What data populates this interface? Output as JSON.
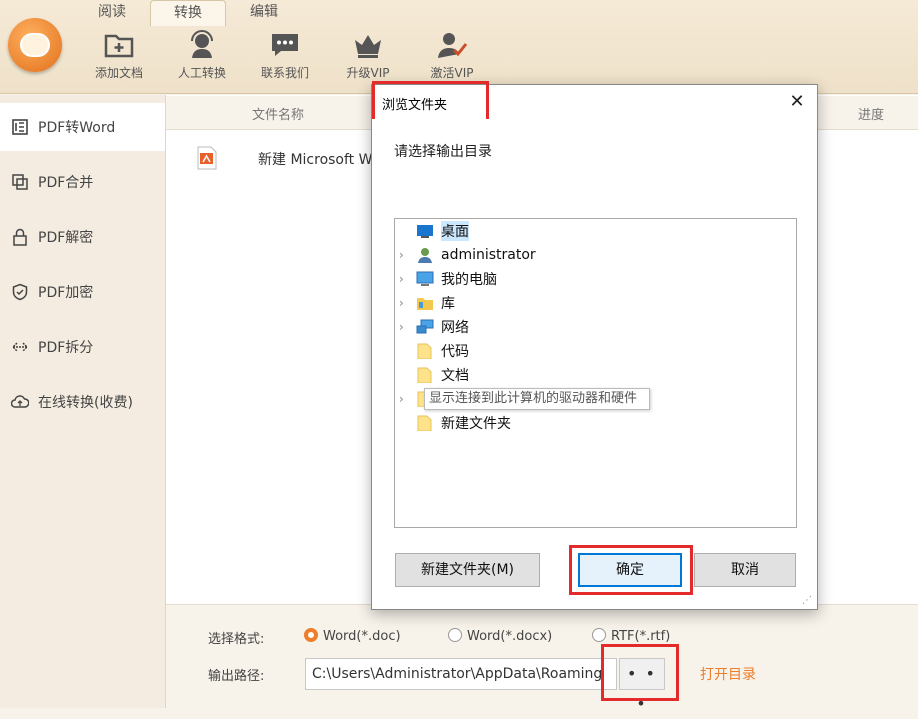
{
  "tabs": [
    {
      "label": "阅读"
    },
    {
      "label": "转换"
    },
    {
      "label": "编辑"
    }
  ],
  "toolbar": [
    {
      "label": "添加文档",
      "icon": "folder-add-icon"
    },
    {
      "label": "人工转换",
      "icon": "headset-person-icon"
    },
    {
      "label": "联系我们",
      "icon": "chat-bubble-icon"
    },
    {
      "label": "升级VIP",
      "icon": "crown-icon"
    },
    {
      "label": "激活VIP",
      "icon": "person-check-icon"
    }
  ],
  "sidebar": {
    "items": [
      {
        "label": "PDF转Word",
        "icon": "pdf-word-icon"
      },
      {
        "label": "PDF合并",
        "icon": "merge-icon"
      },
      {
        "label": "PDF解密",
        "icon": "unlock-icon"
      },
      {
        "label": "PDF加密",
        "icon": "shield-icon"
      },
      {
        "label": "PDF拆分",
        "icon": "split-icon"
      },
      {
        "label": "在线转换(收费)",
        "icon": "cloud-icon"
      }
    ]
  },
  "table": {
    "col_name": "文件名称",
    "col_progress": "进度",
    "rows": [
      {
        "name": "新建 Microsoft W"
      }
    ]
  },
  "bottom": {
    "format_label": "选择格式:",
    "formats": [
      {
        "label": "Word(*.doc)",
        "selected": true
      },
      {
        "label": "Word(*.docx)",
        "selected": false
      },
      {
        "label": "RTF(*.rtf)",
        "selected": false
      }
    ],
    "path_label": "输出路径:",
    "path_value": "C:\\Users\\Administrator\\AppData\\Roaming",
    "browse_label": "• • •",
    "open_dir_label": "打开目录"
  },
  "dialog": {
    "title": "浏览文件夹",
    "close": "✕",
    "prompt": "请选择输出目录",
    "tree": [
      {
        "label": "桌面",
        "icon": "desktop-icon",
        "expandable": false,
        "selected": true
      },
      {
        "label": "administrator",
        "icon": "user-icon",
        "expandable": true
      },
      {
        "label": "我的电脑",
        "icon": "computer-icon",
        "expandable": true
      },
      {
        "label": "库",
        "icon": "library-icon",
        "expandable": true
      },
      {
        "label": "网络",
        "icon": "network-icon",
        "expandable": true
      },
      {
        "label": "代码",
        "icon": "folder-icon",
        "expandable": false
      },
      {
        "label": "文档",
        "icon": "folder-icon",
        "expandable": false
      },
      {
        "label": "",
        "icon": "folder-icon",
        "expandable": true
      },
      {
        "label": "新建文件夹",
        "icon": "folder-icon",
        "expandable": false
      }
    ],
    "tooltip": "显示连接到此计算机的驱动器和硬件",
    "new_folder_button": "新建文件夹(M)",
    "ok_button": "确定",
    "cancel_button": "取消"
  },
  "colors": {
    "accent": "#ef7e2b",
    "highlight": "#e32b2b",
    "selection": "#cce8ff"
  }
}
